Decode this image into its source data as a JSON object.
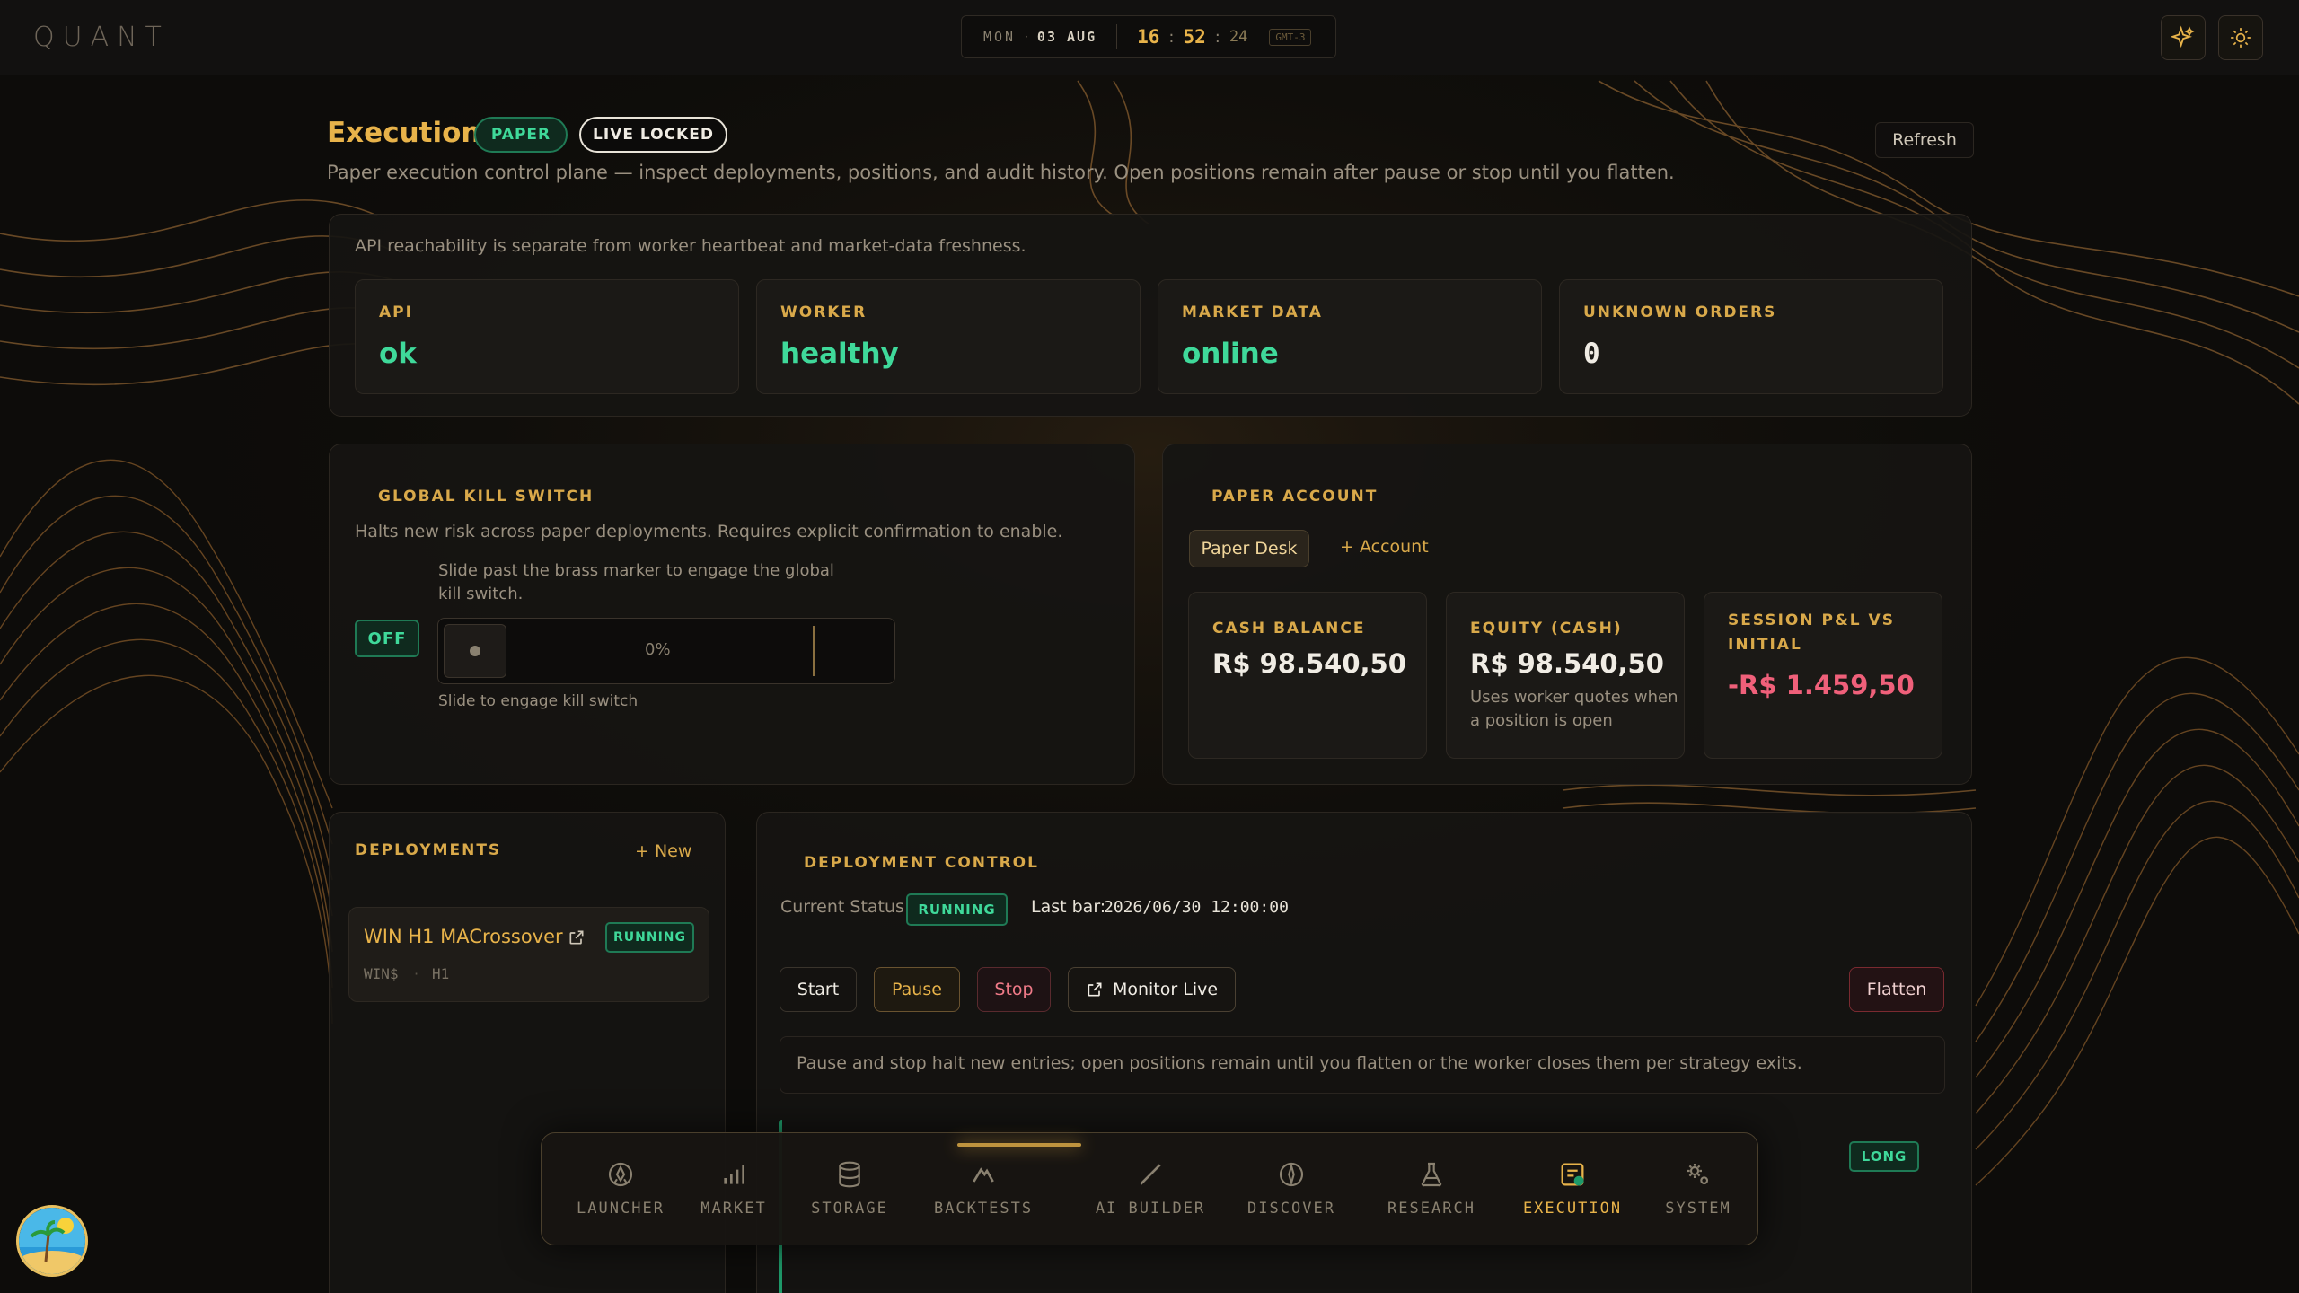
{
  "app": {
    "logo": "QUANT"
  },
  "clock": {
    "day": "MON",
    "date": "03 AUG",
    "hours": "16",
    "minutes": "52",
    "seconds": "24",
    "timezone": "GMT-3"
  },
  "header": {
    "title": "Execution",
    "paper_badge": "PAPER",
    "live_badge": "LIVE LOCKED",
    "subtitle": "Paper execution control plane — inspect deployments, positions, and audit history. Open positions remain after pause or stop until you flatten.",
    "refresh_label": "Refresh"
  },
  "health": {
    "note": "API reachability is separate from worker heartbeat and market-data freshness.",
    "stats": [
      {
        "label": "API",
        "value": "ok"
      },
      {
        "label": "WORKER",
        "value": "healthy"
      },
      {
        "label": "MARKET DATA",
        "value": "online"
      },
      {
        "label": "UNKNOWN ORDERS",
        "value": "0"
      }
    ]
  },
  "kill_switch": {
    "title": "GLOBAL KILL SWITCH",
    "description": "Halts new risk across paper deployments. Requires explicit confirmation to enable.",
    "state": "OFF",
    "instruction": "Slide past the brass marker to engage the global kill switch.",
    "progress": "0%",
    "hint": "Slide to engage kill switch"
  },
  "account": {
    "title": "PAPER ACCOUNT",
    "active_tab": "Paper Desk",
    "add_label": "+ Account",
    "stats": [
      {
        "label": "CASH BALANCE",
        "value": "R$ 98.540,50",
        "note": ""
      },
      {
        "label": "EQUITY (CASH)",
        "value": "R$ 98.540,50",
        "note": "Uses worker quotes when a position is open"
      },
      {
        "label": "SESSION P&L VS INITIAL",
        "value": "-R$ 1.459,50",
        "note": ""
      }
    ]
  },
  "deployments": {
    "title": "DEPLOYMENTS",
    "new_label": "+ New",
    "items": [
      {
        "name": "WIN H1 MACrossover",
        "status": "RUNNING",
        "symbol": "WIN$",
        "sep": "·",
        "timeframe": "H1"
      }
    ]
  },
  "control": {
    "title": "DEPLOYMENT CONTROL",
    "status_label": "Current Status:",
    "status": "RUNNING",
    "last_bar_label": "Last bar:",
    "last_bar": "2026/06/30 12:00:00",
    "buttons": {
      "start": "Start",
      "pause": "Pause",
      "stop": "Stop",
      "monitor": "Monitor Live",
      "flatten": "Flatten"
    },
    "info": "Pause and stop halt new entries; open positions remain until you flatten or the worker closes them per strategy exits.",
    "position_side": "LONG"
  },
  "dock": {
    "items": [
      {
        "label": "LAUNCHER",
        "icon": "rocket-icon"
      },
      {
        "label": "MARKET",
        "icon": "bar-chart-icon"
      },
      {
        "label": "STORAGE",
        "icon": "database-icon"
      },
      {
        "label": "BACKTESTS",
        "icon": "peak-icon"
      },
      {
        "label": "AI BUILDER",
        "icon": "wand-icon"
      },
      {
        "label": "DISCOVER",
        "icon": "compass-icon"
      },
      {
        "label": "RESEARCH",
        "icon": "flask-icon"
      },
      {
        "label": "EXECUTION",
        "icon": "receipt-icon"
      },
      {
        "label": "SYSTEM",
        "icon": "gears-icon"
      }
    ],
    "active": "EXECUTION"
  },
  "colors": {
    "accent": "#e8b34a",
    "success": "#3fd99a",
    "danger": "#f0607a",
    "background": "#0d0c0a"
  }
}
